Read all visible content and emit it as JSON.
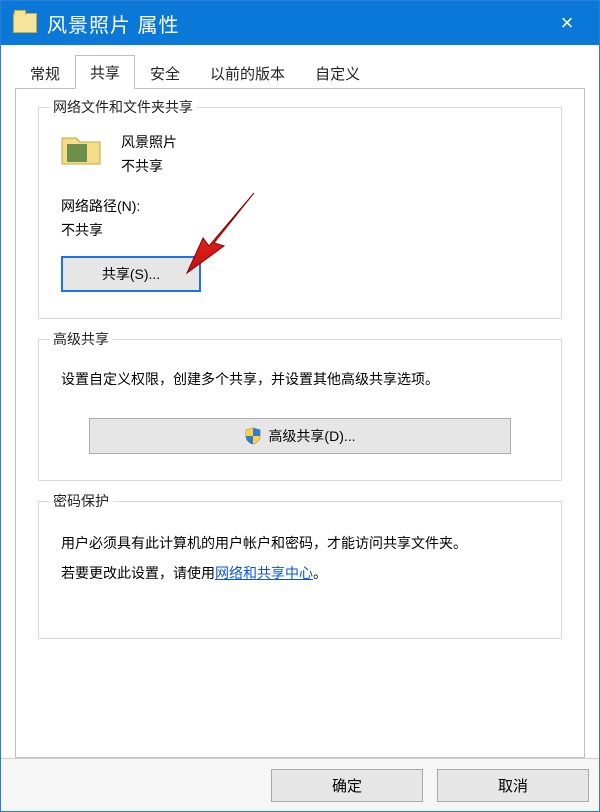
{
  "titlebar": {
    "title": "风景照片 属性",
    "close_symbol": "×"
  },
  "tabs": {
    "items": [
      {
        "label": "常规",
        "active": false
      },
      {
        "label": "共享",
        "active": true
      },
      {
        "label": "安全",
        "active": false
      },
      {
        "label": "以前的版本",
        "active": false
      },
      {
        "label": "自定义",
        "active": false
      }
    ]
  },
  "share_group": {
    "title": "网络文件和文件夹共享",
    "folder_name": "风景照片",
    "share_state": "不共享",
    "path_label": "网络路径(N):",
    "path_value": "不共享",
    "share_button": "共享(S)..."
  },
  "adv_group": {
    "title": "高级共享",
    "desc": "设置自定义权限，创建多个共享，并设置其他高级共享选项。",
    "button": "高级共享(D)..."
  },
  "pw_group": {
    "title": "密码保护",
    "line1": "用户必须具有此计算机的用户帐户和密码，才能访问共享文件夹。",
    "line2_prefix": "若要更改此设置，请使用",
    "line2_link": "网络和共享中心",
    "line2_suffix": "。"
  },
  "footer": {
    "ok": "确定",
    "cancel": "取消"
  }
}
